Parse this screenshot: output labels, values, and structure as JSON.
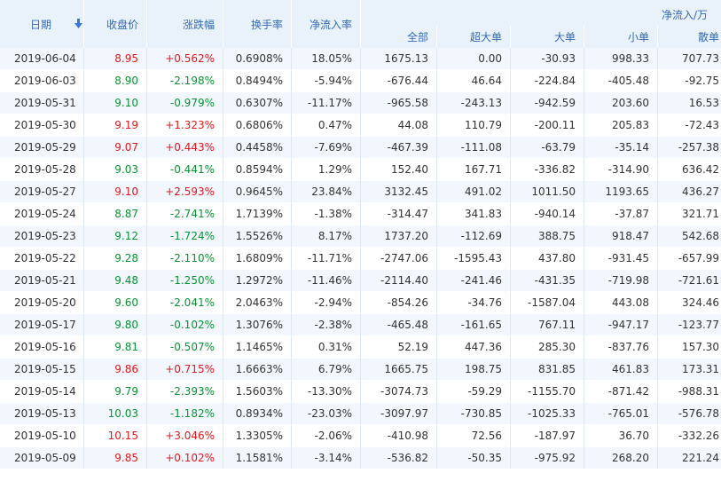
{
  "header": {
    "date": "日期",
    "close": "收盘价",
    "change": "涨跌幅",
    "turnover": "换手率",
    "net_rate": "净流入率",
    "net_group": "净流入/万",
    "all": "全部",
    "super": "超大单",
    "large": "大单",
    "small": "小单",
    "retail": "散单",
    "sort_icon": "arrow-down-icon"
  },
  "colors": {
    "up": "#e4181e",
    "down": "#0c9335",
    "header_bg": "#e9f2fb",
    "header_text": "#3569b5",
    "stripe": "#f2f7fd"
  },
  "rows": [
    {
      "date": "2019-06-04",
      "close": "8.95",
      "change": "+0.562%",
      "turnover": "0.6908%",
      "net_rate": "18.05%",
      "all": "1675.13",
      "super": "0.00",
      "large": "-30.93",
      "small": "998.33",
      "retail": "707.73",
      "dir": "up"
    },
    {
      "date": "2019-06-03",
      "close": "8.90",
      "change": "-2.198%",
      "turnover": "0.8494%",
      "net_rate": "-5.94%",
      "all": "-676.44",
      "super": "46.64",
      "large": "-224.84",
      "small": "-405.48",
      "retail": "-92.75",
      "dir": "down"
    },
    {
      "date": "2019-05-31",
      "close": "9.10",
      "change": "-0.979%",
      "turnover": "0.6307%",
      "net_rate": "-11.17%",
      "all": "-965.58",
      "super": "-243.13",
      "large": "-942.59",
      "small": "203.60",
      "retail": "16.53",
      "dir": "down"
    },
    {
      "date": "2019-05-30",
      "close": "9.19",
      "change": "+1.323%",
      "turnover": "0.6806%",
      "net_rate": "0.47%",
      "all": "44.08",
      "super": "110.79",
      "large": "-200.11",
      "small": "205.83",
      "retail": "-72.43",
      "dir": "up"
    },
    {
      "date": "2019-05-29",
      "close": "9.07",
      "change": "+0.443%",
      "turnover": "0.4458%",
      "net_rate": "-7.69%",
      "all": "-467.39",
      "super": "-111.08",
      "large": "-63.79",
      "small": "-35.14",
      "retail": "-257.38",
      "dir": "up"
    },
    {
      "date": "2019-05-28",
      "close": "9.03",
      "change": "-0.441%",
      "turnover": "0.8594%",
      "net_rate": "1.29%",
      "all": "152.40",
      "super": "167.71",
      "large": "-336.82",
      "small": "-314.90",
      "retail": "636.42",
      "dir": "down"
    },
    {
      "date": "2019-05-27",
      "close": "9.10",
      "change": "+2.593%",
      "turnover": "0.9645%",
      "net_rate": "23.84%",
      "all": "3132.45",
      "super": "491.02",
      "large": "1011.50",
      "small": "1193.65",
      "retail": "436.27",
      "dir": "up"
    },
    {
      "date": "2019-05-24",
      "close": "8.87",
      "change": "-2.741%",
      "turnover": "1.7139%",
      "net_rate": "-1.38%",
      "all": "-314.47",
      "super": "341.83",
      "large": "-940.14",
      "small": "-37.87",
      "retail": "321.71",
      "dir": "down"
    },
    {
      "date": "2019-05-23",
      "close": "9.12",
      "change": "-1.724%",
      "turnover": "1.5526%",
      "net_rate": "8.17%",
      "all": "1737.20",
      "super": "-112.69",
      "large": "388.75",
      "small": "918.47",
      "retail": "542.68",
      "dir": "down"
    },
    {
      "date": "2019-05-22",
      "close": "9.28",
      "change": "-2.110%",
      "turnover": "1.6809%",
      "net_rate": "-11.71%",
      "all": "-2747.06",
      "super": "-1595.43",
      "large": "437.80",
      "small": "-931.45",
      "retail": "-657.99",
      "dir": "down"
    },
    {
      "date": "2019-05-21",
      "close": "9.48",
      "change": "-1.250%",
      "turnover": "1.2972%",
      "net_rate": "-11.46%",
      "all": "-2114.40",
      "super": "-241.46",
      "large": "-431.35",
      "small": "-719.98",
      "retail": "-721.61",
      "dir": "down"
    },
    {
      "date": "2019-05-20",
      "close": "9.60",
      "change": "-2.041%",
      "turnover": "2.0463%",
      "net_rate": "-2.94%",
      "all": "-854.26",
      "super": "-34.76",
      "large": "-1587.04",
      "small": "443.08",
      "retail": "324.46",
      "dir": "down"
    },
    {
      "date": "2019-05-17",
      "close": "9.80",
      "change": "-0.102%",
      "turnover": "1.3076%",
      "net_rate": "-2.38%",
      "all": "-465.48",
      "super": "-161.65",
      "large": "767.11",
      "small": "-947.17",
      "retail": "-123.77",
      "dir": "down"
    },
    {
      "date": "2019-05-16",
      "close": "9.81",
      "change": "-0.507%",
      "turnover": "1.1465%",
      "net_rate": "0.31%",
      "all": "52.19",
      "super": "447.36",
      "large": "285.30",
      "small": "-837.76",
      "retail": "157.30",
      "dir": "down"
    },
    {
      "date": "2019-05-15",
      "close": "9.86",
      "change": "+0.715%",
      "turnover": "1.6663%",
      "net_rate": "6.79%",
      "all": "1665.75",
      "super": "198.75",
      "large": "831.85",
      "small": "461.83",
      "retail": "173.31",
      "dir": "up"
    },
    {
      "date": "2019-05-14",
      "close": "9.79",
      "change": "-2.393%",
      "turnover": "1.5603%",
      "net_rate": "-13.30%",
      "all": "-3074.73",
      "super": "-59.29",
      "large": "-1155.70",
      "small": "-871.42",
      "retail": "-988.31",
      "dir": "down"
    },
    {
      "date": "2019-05-13",
      "close": "10.03",
      "change": "-1.182%",
      "turnover": "0.8934%",
      "net_rate": "-23.03%",
      "all": "-3097.97",
      "super": "-730.85",
      "large": "-1025.33",
      "small": "-765.01",
      "retail": "-576.78",
      "dir": "down"
    },
    {
      "date": "2019-05-10",
      "close": "10.15",
      "change": "+3.046%",
      "turnover": "1.3305%",
      "net_rate": "-2.06%",
      "all": "-410.98",
      "super": "72.56",
      "large": "-187.97",
      "small": "36.70",
      "retail": "-332.26",
      "dir": "up"
    },
    {
      "date": "2019-05-09",
      "close": "9.85",
      "change": "+0.102%",
      "turnover": "1.1581%",
      "net_rate": "-3.14%",
      "all": "-536.82",
      "super": "-50.35",
      "large": "-975.92",
      "small": "268.20",
      "retail": "221.24",
      "dir": "up"
    }
  ]
}
